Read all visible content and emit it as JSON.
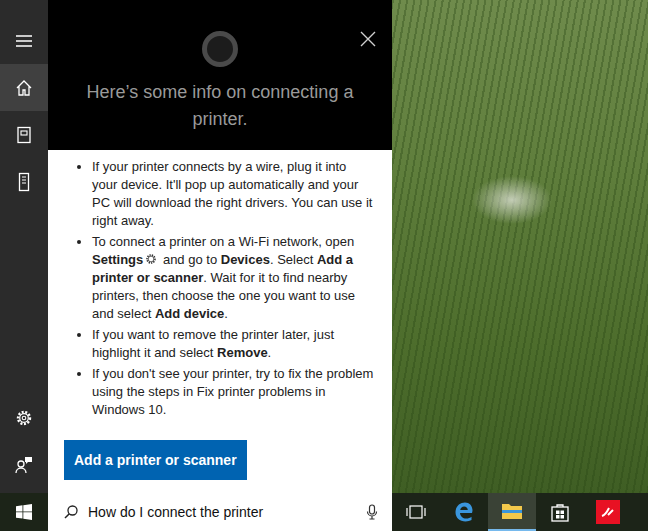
{
  "sidebar": {
    "items": [
      {
        "kind": "menu",
        "selected": false
      },
      {
        "kind": "home",
        "selected": true
      },
      {
        "kind": "notebook",
        "selected": false
      },
      {
        "kind": "devices",
        "selected": false
      }
    ],
    "bottom_items": [
      {
        "kind": "settings",
        "selected": false
      },
      {
        "kind": "feedback",
        "selected": false
      }
    ]
  },
  "cortana": {
    "heading": "Here’s some info on connecting a printer."
  },
  "bullets": [
    [
      {
        "kind": "text",
        "text": "If your printer connects by a wire, plug it into your device. It'll pop up automatically and your PC will download the right drivers. You can use it right away."
      }
    ],
    [
      {
        "kind": "text",
        "text": "To connect a printer on a Wi-Fi network, open "
      },
      {
        "kind": "bold",
        "text": "Settings"
      },
      {
        "kind": "icon",
        "text": ""
      },
      {
        "kind": "text",
        "text": " and go to "
      },
      {
        "kind": "bold",
        "text": "Devices"
      },
      {
        "kind": "text",
        "text": ". Select "
      },
      {
        "kind": "bold",
        "text": "Add a printer or scanner"
      },
      {
        "kind": "text",
        "text": ". Wait for it to find nearby printers, then choose the one you want to use and select "
      },
      {
        "kind": "bold",
        "text": "Add device"
      },
      {
        "kind": "text",
        "text": "."
      }
    ],
    [
      {
        "kind": "text",
        "text": "If you want to remove the printer later, just highlight it and select "
      },
      {
        "kind": "bold",
        "text": "Remove"
      },
      {
        "kind": "text",
        "text": "."
      }
    ],
    [
      {
        "kind": "text",
        "text": "If you don't see your printer, try to fix the problem using the steps in Fix printer problems in Windows 10."
      }
    ]
  ],
  "button": "Add a printer or scanner",
  "search": {
    "value": "How do I connect the printer"
  },
  "taskbar": [
    {
      "kind": "taskview",
      "active": false
    },
    {
      "kind": "edge",
      "active": false
    },
    {
      "kind": "explorer",
      "active": true
    },
    {
      "kind": "store",
      "active": false
    },
    {
      "kind": "app",
      "active": false
    }
  ]
}
